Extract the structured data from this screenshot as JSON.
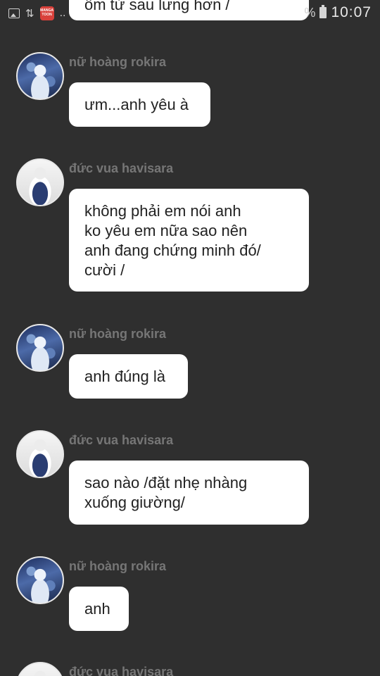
{
  "status_bar": {
    "app_icon_text": "MANGA TOON",
    "dots": "..",
    "percent_sign": "%",
    "time": "10:07"
  },
  "messages": [
    {
      "sender": "",
      "text": "ôm từ sau lưng hơn /"
    },
    {
      "sender": "nữ hoàng rokira",
      "text": "ưm...anh yêu à"
    },
    {
      "sender": "đức vua havisara",
      "text": "không phải em nói anh\nko yêu em nữa sao nên\nanh đang chứng minh đó/\ncười  /"
    },
    {
      "sender": "nữ hoàng rokira",
      "text": "anh đúng là"
    },
    {
      "sender": "đức vua havisara",
      "text": "sao nào /đặt nhẹ nhàng\nxuống giường/"
    },
    {
      "sender": "nữ hoàng rokira",
      "text": "anh"
    },
    {
      "sender": "đức vua havisara",
      "text": ""
    }
  ]
}
